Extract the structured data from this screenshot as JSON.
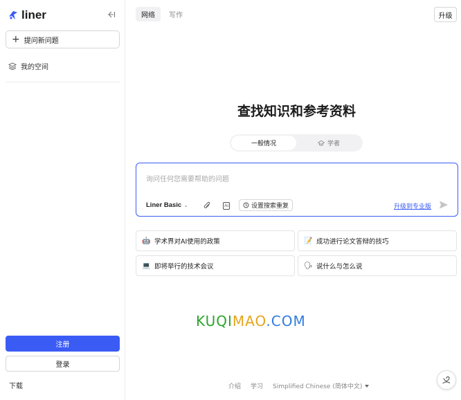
{
  "sidebar": {
    "brand": "liner",
    "new_question": "提问新问题",
    "my_space": "我的空间",
    "signup": "注册",
    "login": "登录",
    "download": "下载"
  },
  "header": {
    "tabs": [
      {
        "label": "网络",
        "active": true
      },
      {
        "label": "写作",
        "active": false
      }
    ],
    "upgrade": "升级"
  },
  "main": {
    "title": "查找知识和参考资料",
    "segments": [
      {
        "label": "一般情况",
        "active": true
      },
      {
        "label": "学者",
        "active": false
      }
    ],
    "search": {
      "placeholder": "询问任何您需要帮助的问题",
      "model": "Liner Basic",
      "priority_button": "设置搜索重复",
      "pro_link": "升级到专业版"
    },
    "suggestions": [
      {
        "icon": "🤖",
        "label": "学术界对AI使用的政策"
      },
      {
        "icon": "📝",
        "label": "成功进行论文答辩的技巧"
      },
      {
        "icon": "💻",
        "label": "即将举行的技术会议"
      },
      {
        "icon": "🗣",
        "label": "说什么与怎么说"
      }
    ]
  },
  "watermark": {
    "part1": "KUQI",
    "part2": "MAO",
    "part3": ".COM"
  },
  "footer": {
    "intro": "介绍",
    "learn": "学习",
    "language": "Simplified Chinese (简体中文)"
  },
  "colors": {
    "accent": "#3b5bf5",
    "tab_bg": "#f1f1f3"
  }
}
